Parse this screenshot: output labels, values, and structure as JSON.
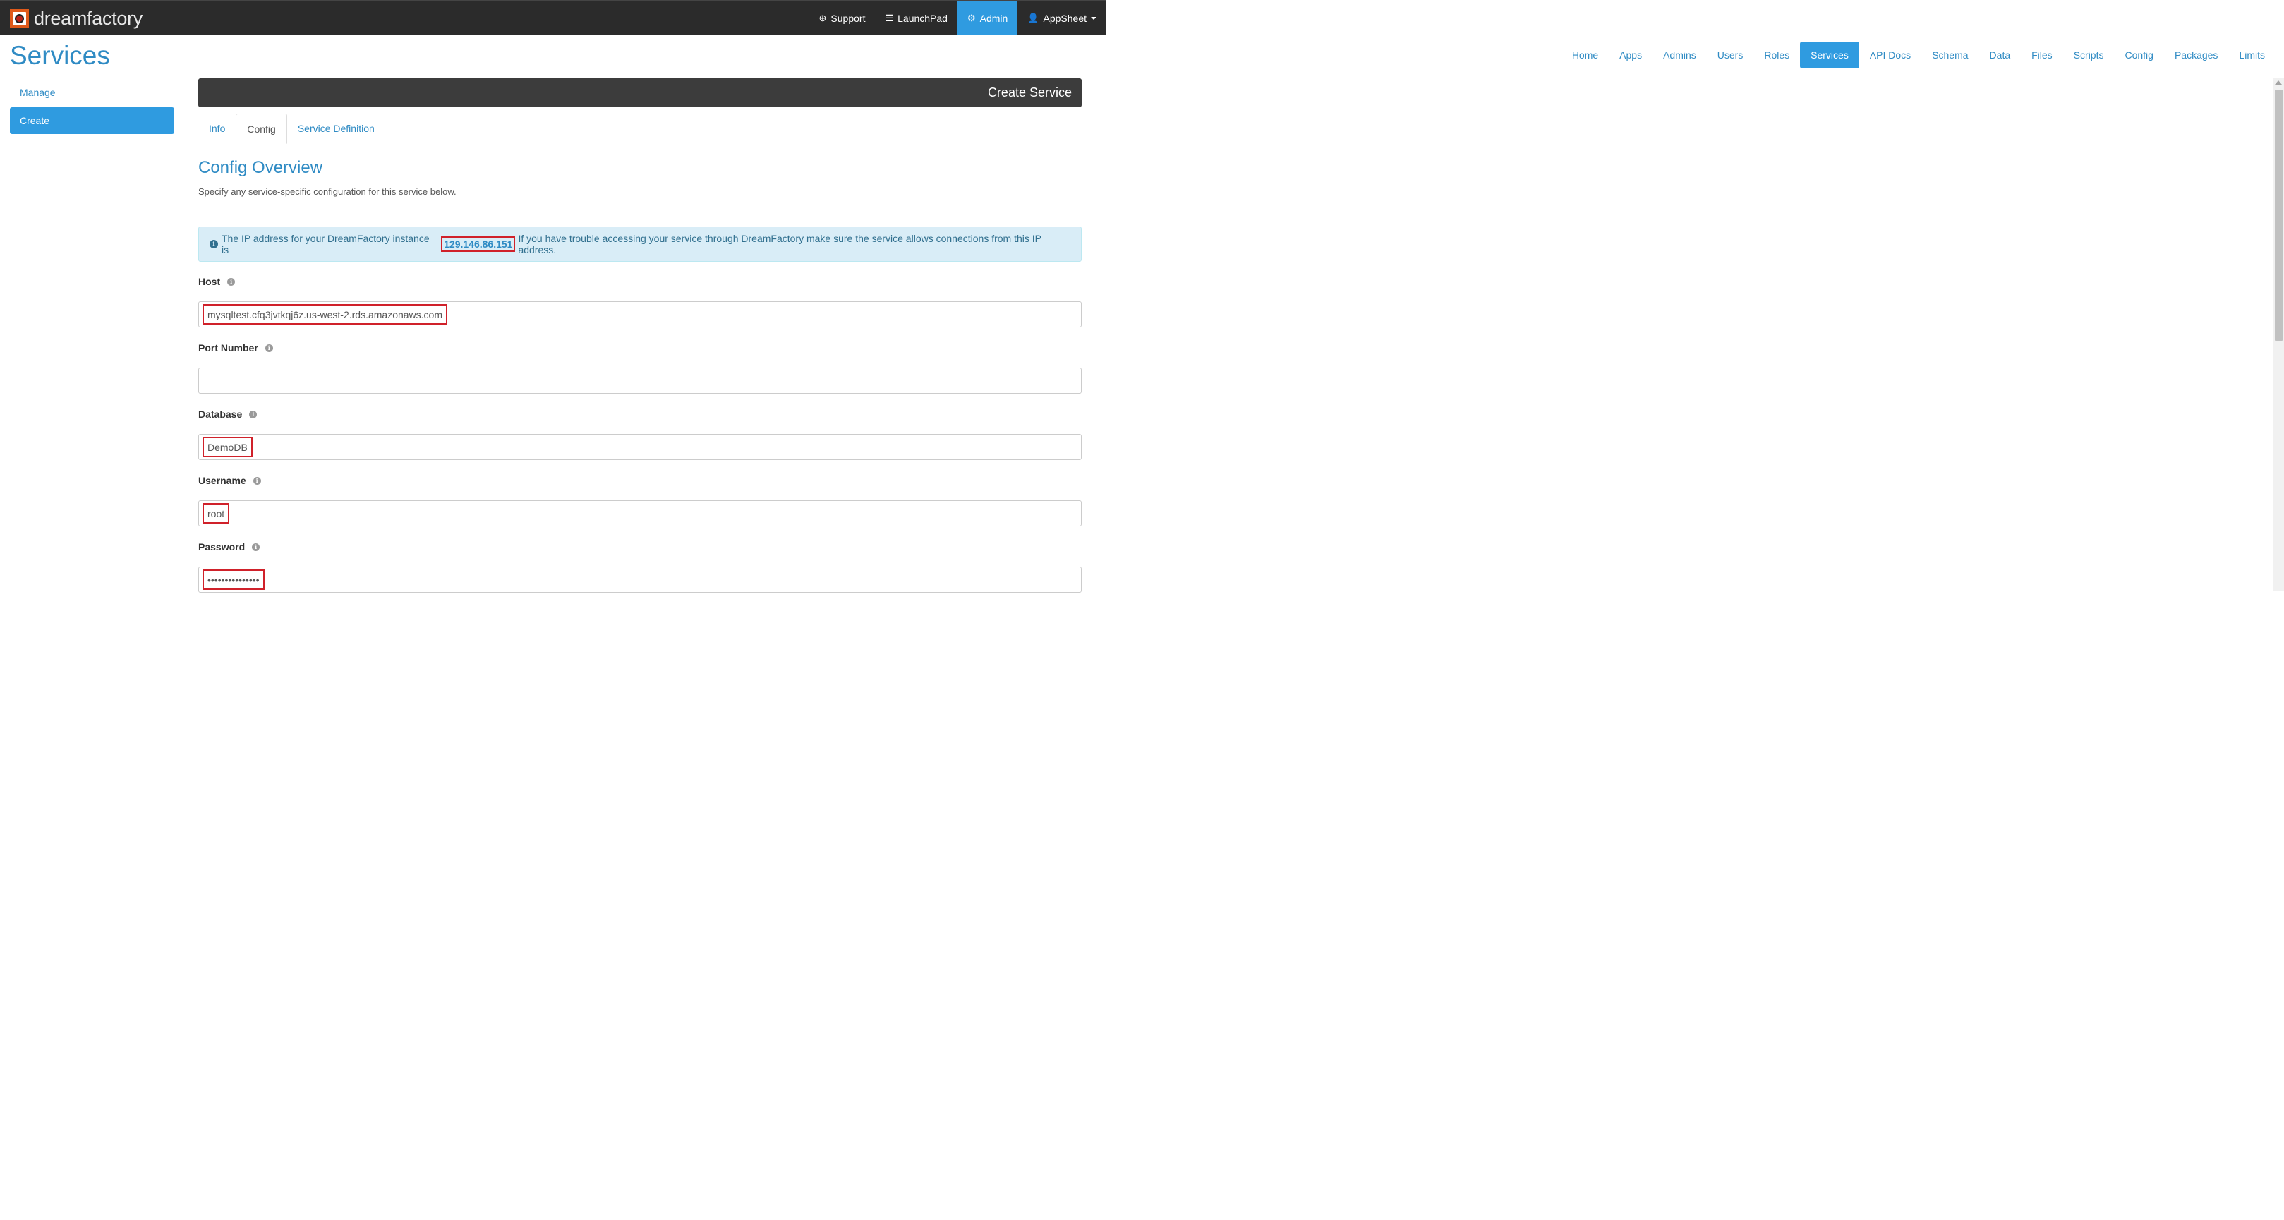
{
  "brand": {
    "name": "dreamfactory"
  },
  "topnav": {
    "support": "Support",
    "launchpad": "LaunchPad",
    "admin": "Admin",
    "user": "AppSheet"
  },
  "page_title": "Services",
  "mainnav": [
    "Home",
    "Apps",
    "Admins",
    "Users",
    "Roles",
    "Services",
    "API Docs",
    "Schema",
    "Data",
    "Files",
    "Scripts",
    "Config",
    "Packages",
    "Limits"
  ],
  "sidebar": {
    "manage": "Manage",
    "create": "Create"
  },
  "panel_title": "Create Service",
  "tabs": {
    "info": "Info",
    "config": "Config",
    "service_definition": "Service Definition"
  },
  "config": {
    "title": "Config Overview",
    "subtitle": "Specify any service-specific configuration for this service below.",
    "alert_before": "The IP address for your DreamFactory instance is",
    "ip": "129.146.86.151",
    "alert_after": "If you have trouble accessing your service through DreamFactory make sure the service allows connections from this IP address."
  },
  "fields": {
    "host": {
      "label": "Host",
      "value": "mysqltest.cfq3jvtkqj6z.us-west-2.rds.amazonaws.com"
    },
    "port": {
      "label": "Port Number",
      "value": ""
    },
    "database": {
      "label": "Database",
      "value": "DemoDB"
    },
    "username": {
      "label": "Username",
      "value": "root"
    },
    "password": {
      "label": "Password",
      "value": "•••••••••••••••"
    }
  },
  "colors": {
    "accent": "#2f9be0",
    "navbar": "#2b2b2b",
    "highlight": "#d0212a"
  }
}
